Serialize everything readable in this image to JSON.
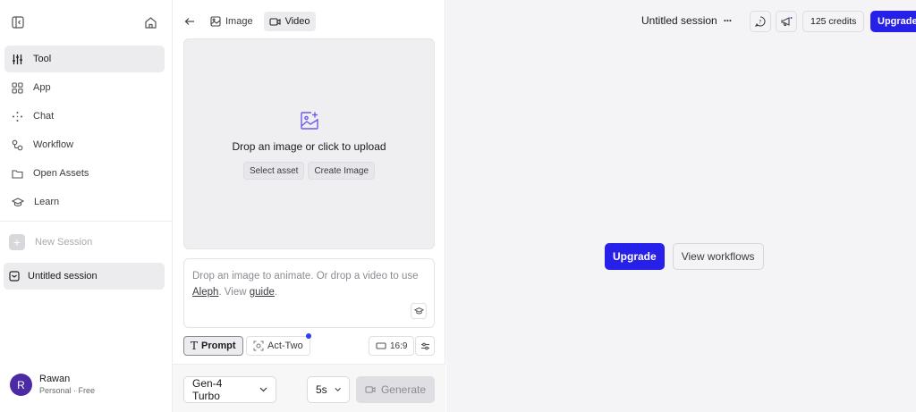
{
  "sidebar": {
    "items": [
      {
        "label": "Tool",
        "icon": "sliders-icon",
        "active": true
      },
      {
        "label": "App",
        "icon": "grid-icon",
        "active": false
      },
      {
        "label": "Chat",
        "icon": "sparkle-icon",
        "active": false
      },
      {
        "label": "Workflow",
        "icon": "workflow-icon",
        "active": false
      },
      {
        "label": "Open Assets",
        "icon": "folder-icon",
        "active": false
      },
      {
        "label": "Learn",
        "icon": "graduation-cap-icon",
        "active": false
      }
    ],
    "new_session_label": "New Session",
    "sessions": [
      {
        "label": "Untitled session"
      }
    ],
    "user": {
      "initial": "R",
      "name": "Rawan",
      "plan": "Personal · Free"
    }
  },
  "panel": {
    "tabs": [
      {
        "label": "Image",
        "active": false
      },
      {
        "label": "Video",
        "active": true
      }
    ],
    "dropzone": {
      "title": "Drop an image or click to upload",
      "select_asset": "Select asset",
      "create_image": "Create Image"
    },
    "prompt": {
      "text_before": "Drop an image to animate. Or drop a video to use ",
      "link_aleph": "Aleph",
      "text_mid": ". View ",
      "link_guide": "guide",
      "text_end": "."
    },
    "modes": {
      "prompt": "Prompt",
      "act_two": "Act-Two"
    },
    "aspect_ratio": "16:9",
    "model": "Gen-4 Turbo",
    "duration": "5s",
    "generate": "Generate"
  },
  "main": {
    "session_title": "Untitled session",
    "more": "···",
    "credits": "125 credits",
    "upgrade_top": "Upgrade",
    "upgrade_center": "Upgrade",
    "view_workflows": "View workflows"
  },
  "colors": {
    "accent": "#2620e8",
    "avatar": "#4b2ba3",
    "dot": "#2e3df0"
  }
}
